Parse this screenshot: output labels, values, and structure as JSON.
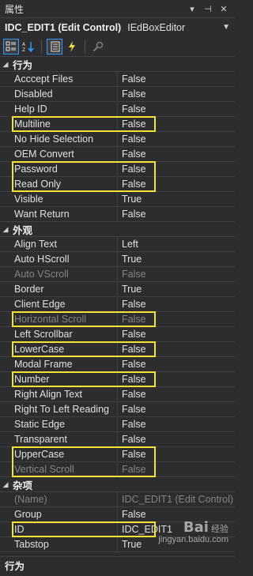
{
  "window": {
    "title": "属性"
  },
  "object_selector": {
    "name": "IDC_EDIT1 (Edit Control)",
    "type": "IEdBoxEditor"
  },
  "toolbar": {
    "buttons": [
      {
        "icon": "categorized-icon",
        "active": true
      },
      {
        "icon": "alphabetical-icon",
        "active": false
      },
      {
        "icon": "properties-icon",
        "active": true
      },
      {
        "icon": "events-icon",
        "active": false
      },
      {
        "icon": "property-pages-icon",
        "active": false
      }
    ]
  },
  "categories": [
    {
      "name": "行为",
      "rows": [
        {
          "name": "Acccept Files",
          "value": "False"
        },
        {
          "name": "Disabled",
          "value": "False"
        },
        {
          "name": "Help ID",
          "value": "False"
        },
        {
          "name": "Multiline",
          "value": "False",
          "highlight": true
        },
        {
          "name": "No Hide Selection",
          "value": "False"
        },
        {
          "name": "OEM Convert",
          "value": "False"
        },
        {
          "name": "Password",
          "value": "False",
          "highlight": true
        },
        {
          "name": "Read Only",
          "value": "False",
          "highlight": true
        },
        {
          "name": "Visible",
          "value": "True"
        },
        {
          "name": "Want Return",
          "value": "False"
        }
      ]
    },
    {
      "name": "外观",
      "rows": [
        {
          "name": "Align Text",
          "value": "Left"
        },
        {
          "name": "Auto HScroll",
          "value": "True"
        },
        {
          "name": "Auto VScroll",
          "value": "False",
          "disabled": true
        },
        {
          "name": "Border",
          "value": "True"
        },
        {
          "name": "Client Edge",
          "value": "False"
        },
        {
          "name": "Horizontal Scroll",
          "value": "False",
          "disabled": true,
          "highlight": true
        },
        {
          "name": "Left Scrollbar",
          "value": "False"
        },
        {
          "name": "LowerCase",
          "value": "False",
          "highlight": true
        },
        {
          "name": "Modal Frame",
          "value": "False"
        },
        {
          "name": "Number",
          "value": "False",
          "highlight": true
        },
        {
          "name": "Right Align Text",
          "value": "False"
        },
        {
          "name": "Right To Left Reading",
          "value": "False"
        },
        {
          "name": "Static Edge",
          "value": "False"
        },
        {
          "name": "Transparent",
          "value": "False"
        },
        {
          "name": "UpperCase",
          "value": "False",
          "highlight": true
        },
        {
          "name": "Vertical Scroll",
          "value": "False",
          "disabled": true,
          "highlight": true
        }
      ]
    },
    {
      "name": "杂项",
      "rows": [
        {
          "name": "(Name)",
          "value": "IDC_EDIT1 (Edit Control)",
          "disabled": true
        },
        {
          "name": "Group",
          "value": "False"
        },
        {
          "name": "ID",
          "value": "IDC_EDIT1",
          "highlight": true
        },
        {
          "name": "Tabstop",
          "value": "True"
        }
      ]
    }
  ],
  "description": {
    "title": "行为"
  },
  "watermark": {
    "line1": "Bai",
    "line2": "经验",
    "url": "jingyan.baidu.com"
  },
  "colors": {
    "highlight": "#f3e333",
    "background": "#2d2d30",
    "grid_line": "#3f3f46",
    "disabled_text": "#858585"
  }
}
